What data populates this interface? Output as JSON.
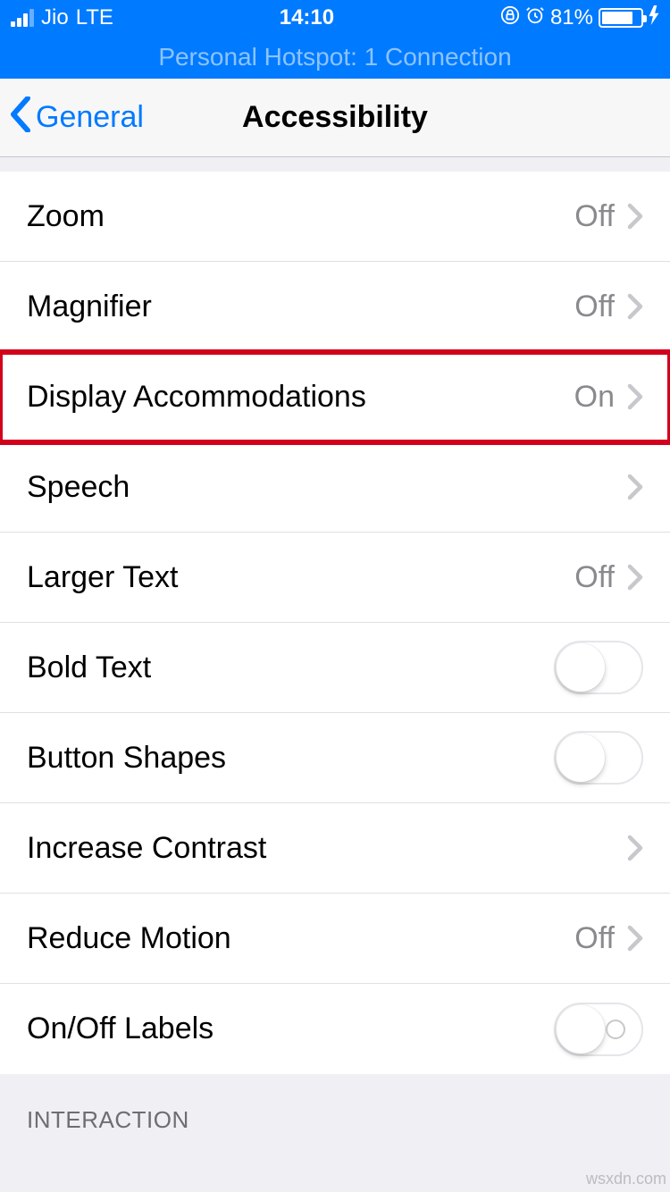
{
  "status": {
    "carrier": "Jio",
    "network": "LTE",
    "time": "14:10",
    "battery_percent": "81%"
  },
  "hotspot_banner": "Personal Hotspot: 1 Connection",
  "nav": {
    "back_label": "General",
    "title": "Accessibility"
  },
  "rows": {
    "zoom": {
      "label": "Zoom",
      "value": "Off"
    },
    "magnifier": {
      "label": "Magnifier",
      "value": "Off"
    },
    "display_acc": {
      "label": "Display Accommodations",
      "value": "On"
    },
    "speech": {
      "label": "Speech"
    },
    "larger_text": {
      "label": "Larger Text",
      "value": "Off"
    },
    "bold_text": {
      "label": "Bold Text"
    },
    "button_shapes": {
      "label": "Button Shapes"
    },
    "increase_contrast": {
      "label": "Increase Contrast"
    },
    "reduce_motion": {
      "label": "Reduce Motion",
      "value": "Off"
    },
    "onoff_labels": {
      "label": "On/Off Labels"
    }
  },
  "section_header": "INTERACTION",
  "watermark": "wsxdn.com"
}
